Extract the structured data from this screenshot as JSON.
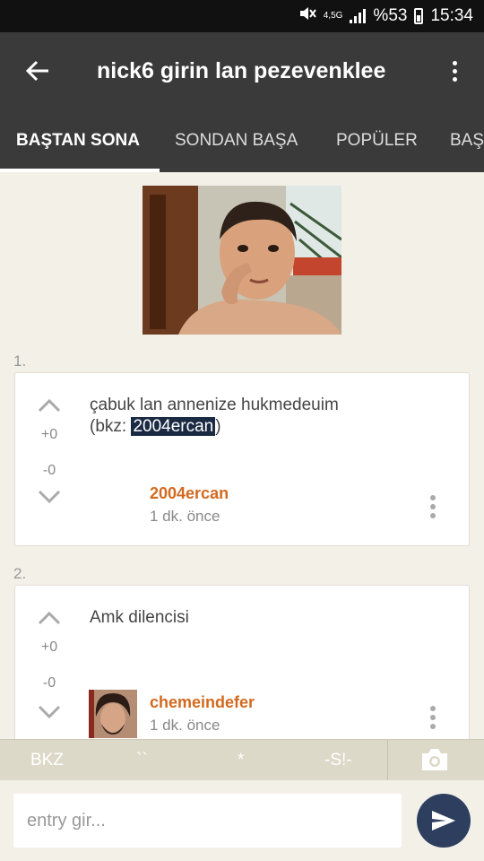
{
  "status_bar": {
    "network": "4,5G",
    "battery": "%53",
    "time": "15:34"
  },
  "header": {
    "title": "nick6 girin lan pezevenklee"
  },
  "tabs": [
    {
      "label": "BAŞTAN SONA",
      "active": true
    },
    {
      "label": "SONDAN BAŞA",
      "active": false
    },
    {
      "label": "POPÜLER",
      "active": false
    },
    {
      "label": "BAŞ",
      "active": false
    }
  ],
  "entries": [
    {
      "index": "1.",
      "text_line1": "çabuk lan annenize hukmedeuim",
      "bkz_prefix": "(bkz: ",
      "bkz_link": "2004ercan",
      "bkz_suffix": ")",
      "upvotes": "+0",
      "downvotes": "-0",
      "author": "2004ercan",
      "time": "1 dk. önce"
    },
    {
      "index": "2.",
      "text": "Amk dilencisi",
      "upvotes": "+0",
      "downvotes": "-0",
      "author": "chemeindefer",
      "time": "1 dk. önce"
    }
  ],
  "format_bar": {
    "bkz": "BKZ",
    "hede": "``",
    "star": "*",
    "spoiler": "-S!-"
  },
  "composer": {
    "placeholder": "entry gir..."
  },
  "colors": {
    "app_bar": "#3a3a3a",
    "background": "#f3f0e8",
    "author": "#d2691e",
    "send_button": "#2d3e5f",
    "bkz_highlight": "#1b2a43"
  }
}
